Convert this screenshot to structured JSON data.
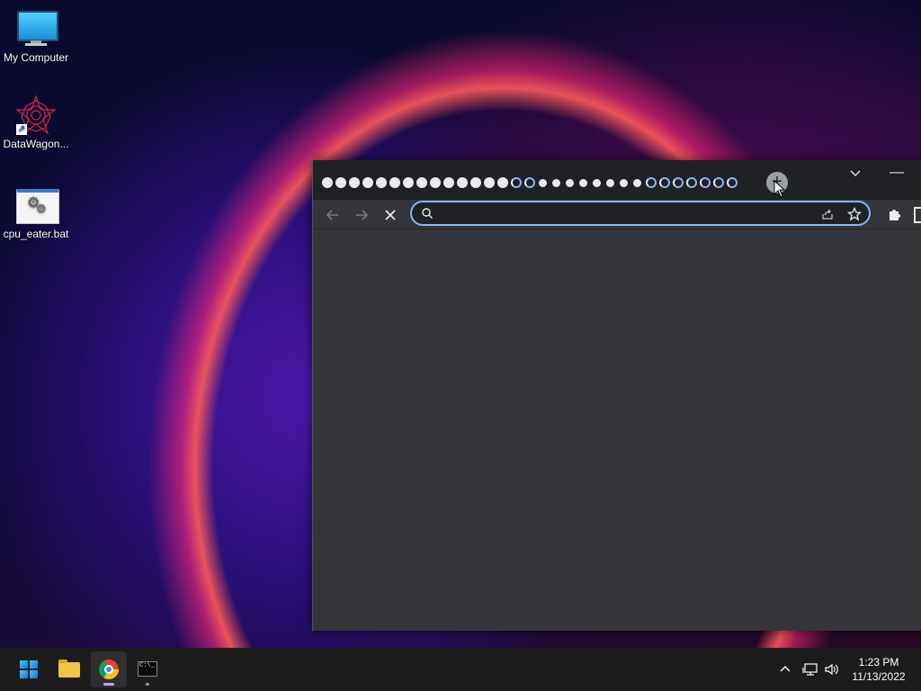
{
  "desktop": {
    "icons": [
      {
        "label": "My Computer",
        "icon": "monitor-icon"
      },
      {
        "label": "DataWagon...",
        "icon": "datawagon-star-icon"
      },
      {
        "label": "cpu_eater.bat",
        "icon": "batch-file-icon"
      }
    ]
  },
  "browser": {
    "tab_count": 31,
    "tab_favicon": "globe-icon",
    "new_tab_symbol": "+",
    "tab_search_symbol": "⌄",
    "minimize_symbol": "—",
    "omnibox": {
      "value": "",
      "placeholder": ""
    },
    "accent": "#8ab4f8",
    "background": "#35363a"
  },
  "taskbar": {
    "apps": [
      "start-button",
      "file-explorer",
      "chrome",
      "terminal"
    ],
    "tray": {
      "chevron": "^"
    },
    "clock": {
      "time": "1:23 PM",
      "date": "11/13/2022"
    }
  }
}
